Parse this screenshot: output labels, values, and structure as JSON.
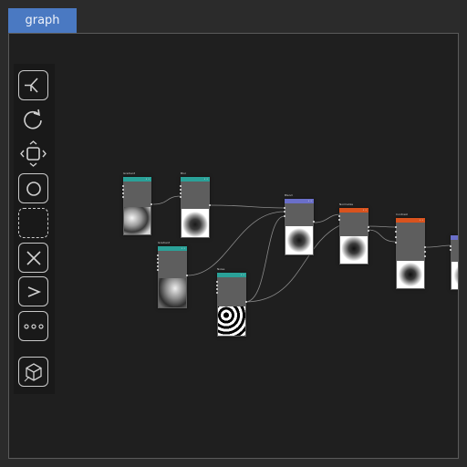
{
  "tab": {
    "label": "graph"
  },
  "toolbar": {
    "tools": [
      {
        "name": "graph-branch-tool",
        "icon": "branch-icon"
      },
      {
        "name": "rotate-tool",
        "icon": "rotate-icon"
      },
      {
        "name": "move-tool",
        "icon": "move-icon"
      },
      {
        "name": "circle-tool",
        "icon": "circle-icon"
      },
      {
        "name": "selection-tool",
        "icon": "dashed-square-icon"
      },
      {
        "name": "delete-tool",
        "icon": "x-icon"
      },
      {
        "name": "output-tool",
        "icon": "chevron-right-icon"
      },
      {
        "name": "more-tool",
        "icon": "ellipsis-icon"
      },
      {
        "name": "3d-view-tool",
        "icon": "cube-icon"
      }
    ]
  },
  "colors": {
    "teal": "#2aa198",
    "blue": "#6a6fc9",
    "orange": "#d9531e"
  },
  "nodes": [
    {
      "id": "n1",
      "title": "Gradient",
      "header_color": "#2aa198",
      "inputs": [
        "",
        "",
        "",
        ""
      ],
      "outputs": [
        ""
      ]
    },
    {
      "id": "n2",
      "title": "Blur",
      "header_color": "#2aa198",
      "inputs": [
        "",
        "",
        "",
        ""
      ],
      "outputs": [
        ""
      ]
    },
    {
      "id": "n3",
      "title": "Gradient",
      "header_color": "#2aa198",
      "inputs": [
        "",
        "",
        "",
        "",
        ""
      ],
      "outputs": [
        ""
      ]
    },
    {
      "id": "n4",
      "title": "Noise",
      "header_color": "#2aa198",
      "inputs": [
        "",
        "",
        "",
        ""
      ],
      "outputs": [
        ""
      ]
    },
    {
      "id": "n5",
      "title": "Blend",
      "header_color": "#6a6fc9",
      "inputs": [
        "",
        "",
        ""
      ],
      "outputs": [
        ""
      ]
    },
    {
      "id": "n6",
      "title": "Normalize",
      "header_color": "#d9531e",
      "inputs": [
        "",
        ""
      ],
      "outputs": [
        ""
      ]
    },
    {
      "id": "n7",
      "title": "Contrast",
      "header_color": "#d9531e",
      "inputs": [
        "",
        "",
        "",
        ""
      ],
      "outputs": [
        "",
        "",
        ""
      ]
    },
    {
      "id": "n8",
      "title": "",
      "header_color": "#6a6fc9",
      "inputs": [
        ""
      ],
      "outputs": [
        "",
        ""
      ]
    }
  ]
}
